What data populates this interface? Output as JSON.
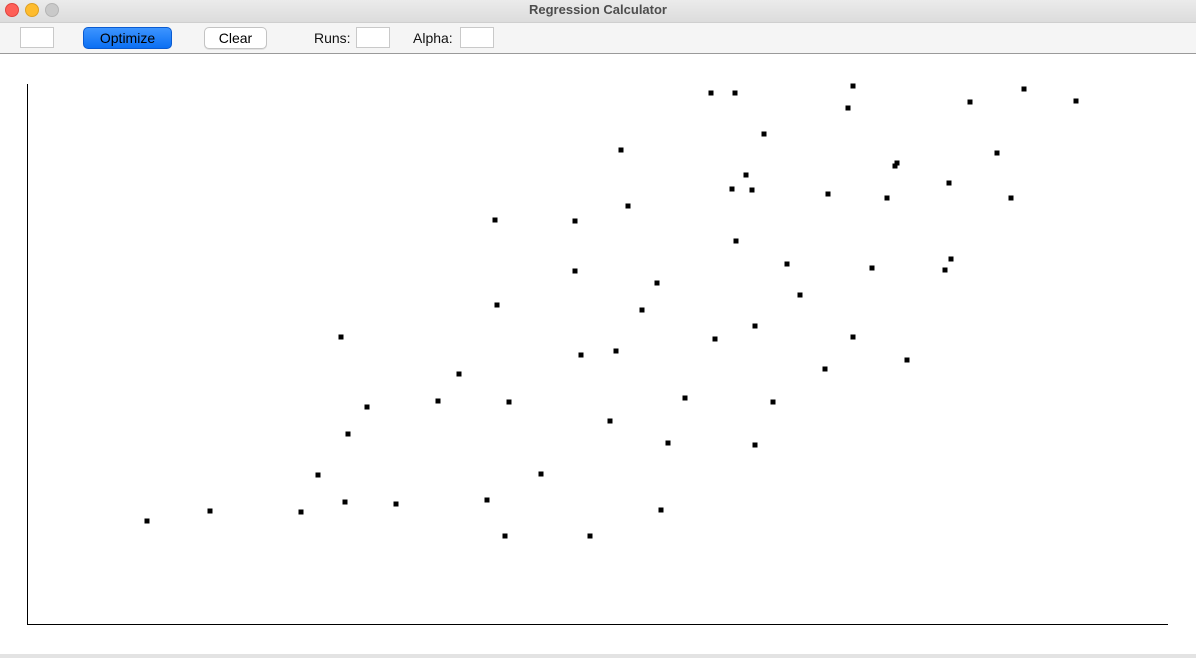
{
  "window": {
    "title": "Regression Calculator"
  },
  "toolbar": {
    "first_field_value": "",
    "optimize_label": "Optimize",
    "clear_label": "Clear",
    "runs_label": "Runs:",
    "runs_value": "",
    "alpha_label": "Alpha:",
    "alpha_value": ""
  },
  "colors": {
    "primary_button": "#0b6ff3",
    "point": "#000000",
    "axis": "#000000",
    "canvas": "#ffffff"
  },
  "chart_data": {
    "type": "scatter",
    "title": "",
    "xlabel": "",
    "ylabel": "",
    "xlim": [
      0,
      1140
    ],
    "ylim": [
      0,
      540
    ],
    "grid": false,
    "series": [
      {
        "points": [
          [
            120,
            103
          ],
          [
            183,
            113
          ],
          [
            274,
            112
          ],
          [
            318,
            122
          ],
          [
            369,
            120
          ],
          [
            460,
            124
          ],
          [
            478,
            88
          ],
          [
            563,
            88
          ],
          [
            634,
            114
          ],
          [
            514,
            150
          ],
          [
            291,
            149
          ],
          [
            321,
            190
          ],
          [
            340,
            217
          ],
          [
            411,
            223
          ],
          [
            482,
            222
          ],
          [
            583,
            203
          ],
          [
            641,
            181
          ],
          [
            658,
            226
          ],
          [
            728,
            179
          ],
          [
            746,
            222
          ],
          [
            432,
            250
          ],
          [
            554,
            269
          ],
          [
            589,
            273
          ],
          [
            688,
            285
          ],
          [
            728,
            298
          ],
          [
            798,
            255
          ],
          [
            826,
            287
          ],
          [
            880,
            264
          ],
          [
            314,
            287
          ],
          [
            470,
            319
          ],
          [
            548,
            353
          ],
          [
            615,
            314
          ],
          [
            630,
            341
          ],
          [
            760,
            360
          ],
          [
            773,
            329
          ],
          [
            845,
            356
          ],
          [
            918,
            354
          ],
          [
            924,
            365
          ],
          [
            709,
            383
          ],
          [
            548,
            403
          ],
          [
            601,
            418
          ],
          [
            468,
            404
          ],
          [
            705,
            435
          ],
          [
            719,
            449
          ],
          [
            725,
            434
          ],
          [
            737,
            490
          ],
          [
            801,
            430
          ],
          [
            860,
            426
          ],
          [
            870,
            461
          ],
          [
            922,
            441
          ],
          [
            970,
            471
          ],
          [
            984,
            426
          ],
          [
            594,
            474
          ],
          [
            684,
            531
          ],
          [
            708,
            531
          ],
          [
            821,
            516
          ],
          [
            826,
            538
          ],
          [
            868,
            458
          ],
          [
            943,
            522
          ],
          [
            997,
            535
          ],
          [
            1049,
            523
          ]
        ]
      }
    ]
  }
}
